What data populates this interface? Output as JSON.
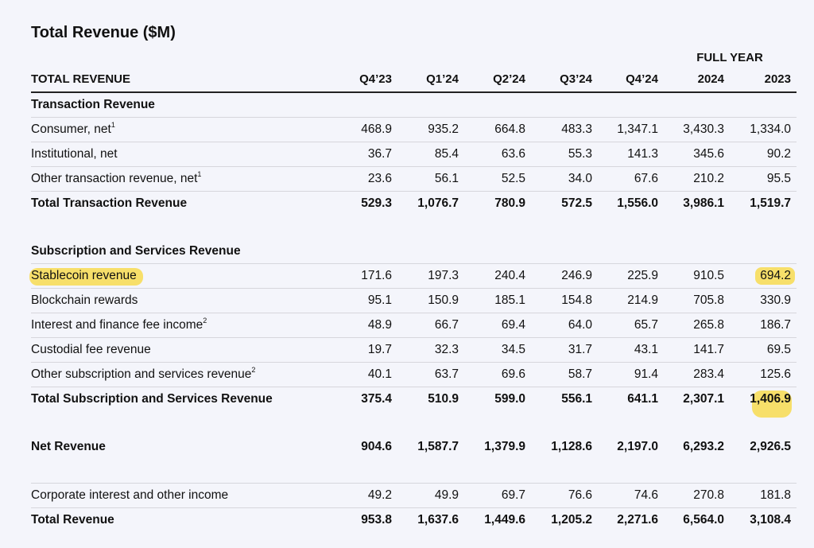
{
  "title": "Total Revenue ($M)",
  "full_year_label": "FULL YEAR",
  "header": {
    "label": "TOTAL REVENUE",
    "columns": [
      "Q4’23",
      "Q1’24",
      "Q2’24",
      "Q3’24",
      "Q4’24",
      "2024",
      "2023"
    ]
  },
  "highlight_color": "#f7df6a",
  "sections": {
    "transaction": {
      "heading": "Transaction Revenue",
      "rows": [
        {
          "label": "Consumer, net",
          "sup": "1",
          "values": [
            "468.9",
            "935.2",
            "664.8",
            "483.3",
            "1,347.1",
            "3,430.3",
            "1,334.0"
          ]
        },
        {
          "label": "Institutional, net",
          "sup": "",
          "values": [
            "36.7",
            "85.4",
            "63.6",
            "55.3",
            "141.3",
            "345.6",
            "90.2"
          ]
        },
        {
          "label": "Other transaction revenue, net",
          "sup": "1",
          "values": [
            "23.6",
            "56.1",
            "52.5",
            "34.0",
            "67.6",
            "210.2",
            "95.5"
          ]
        }
      ],
      "total": {
        "label": "Total Transaction Revenue",
        "values": [
          "529.3",
          "1,076.7",
          "780.9",
          "572.5",
          "1,556.0",
          "3,986.1",
          "1,519.7"
        ]
      }
    },
    "subscription": {
      "heading": "Subscription and Services Revenue",
      "rows": [
        {
          "label": "Stablecoin revenue",
          "sup": "",
          "values": [
            "171.6",
            "197.3",
            "240.4",
            "246.9",
            "225.9",
            "910.5",
            "694.2"
          ]
        },
        {
          "label": "Blockchain rewards",
          "sup": "",
          "values": [
            "95.1",
            "150.9",
            "185.1",
            "154.8",
            "214.9",
            "705.8",
            "330.9"
          ]
        },
        {
          "label": "Interest and finance fee income",
          "sup": "2",
          "values": [
            "48.9",
            "66.7",
            "69.4",
            "64.0",
            "65.7",
            "265.8",
            "186.7"
          ]
        },
        {
          "label": "Custodial fee revenue",
          "sup": "",
          "values": [
            "19.7",
            "32.3",
            "34.5",
            "31.7",
            "43.1",
            "141.7",
            "69.5"
          ]
        },
        {
          "label": "Other subscription and services revenue",
          "sup": "2",
          "values": [
            "40.1",
            "63.7",
            "69.6",
            "58.7",
            "91.4",
            "283.4",
            "125.6"
          ]
        }
      ],
      "total": {
        "label": "Total Subscription and Services Revenue",
        "values": [
          "375.4",
          "510.9",
          "599.0",
          "556.1",
          "641.1",
          "2,307.1",
          "1,406.9"
        ]
      }
    }
  },
  "net_revenue": {
    "label": "Net Revenue",
    "values": [
      "904.6",
      "1,587.7",
      "1,379.9",
      "1,128.6",
      "2,197.0",
      "6,293.2",
      "2,926.5"
    ]
  },
  "corporate_interest": {
    "label": "Corporate interest and other income",
    "values": [
      "49.2",
      "49.9",
      "69.7",
      "76.6",
      "74.6",
      "270.8",
      "181.8"
    ]
  },
  "total_revenue": {
    "label": "Total Revenue",
    "values": [
      "953.8",
      "1,637.6",
      "1,449.6",
      "1,205.2",
      "2,271.6",
      "6,564.0",
      "3,108.4"
    ]
  }
}
